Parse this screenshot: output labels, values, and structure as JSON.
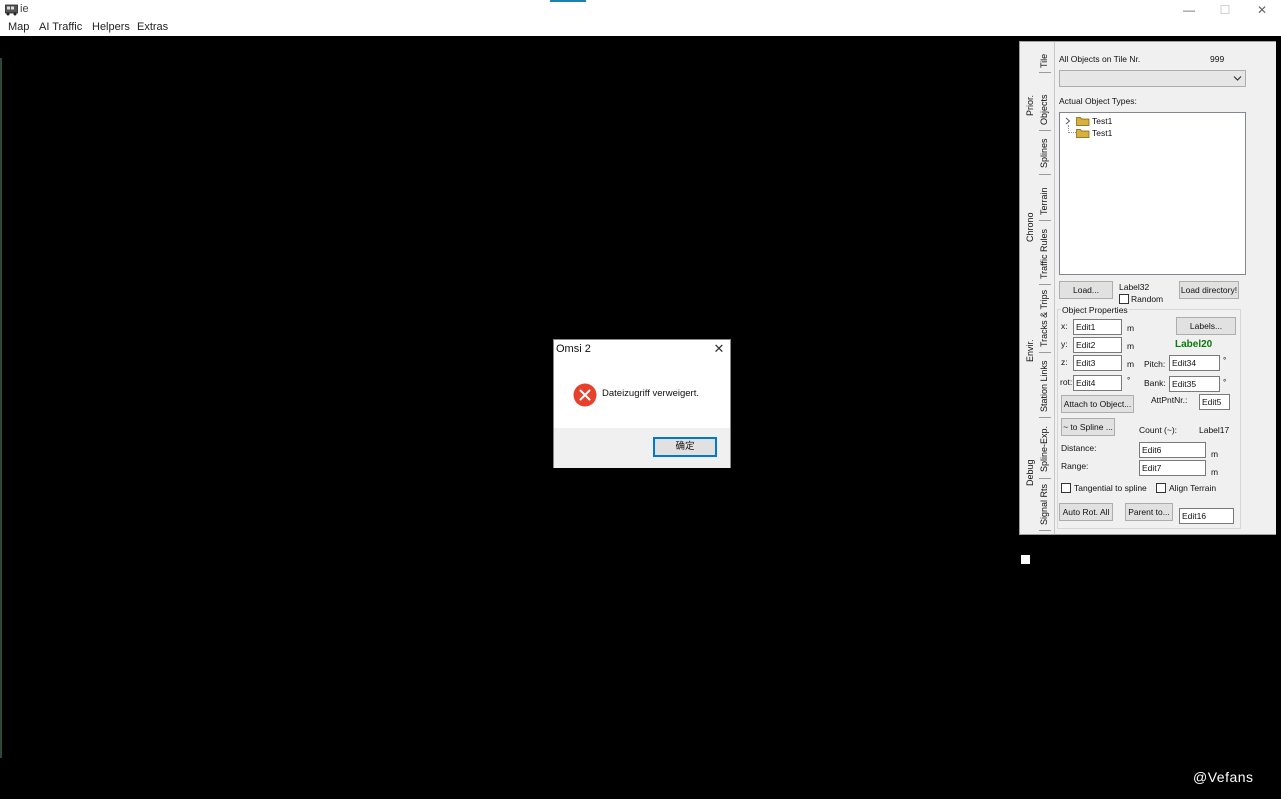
{
  "window": {
    "title": "ie",
    "minimize_glyph": "—",
    "maximize_glyph": "☐",
    "close_glyph": "✕"
  },
  "menu": [
    "Map",
    "AI Traffic",
    "Helpers",
    "Extras"
  ],
  "side_tabs": {
    "right": [
      "Tile",
      "Objects",
      "Splines",
      "Terrain",
      "Traffic Rules",
      "Tracks & Trips",
      "Station Links",
      "Spline-Exp.",
      "Signal Rts"
    ],
    "left": [
      "Prior.",
      "Chrono",
      "Envir.",
      "Debug"
    ]
  },
  "objects_panel": {
    "tile_label": "All Objects on Tile Nr.",
    "tile_number": "999",
    "object_types_label": "Actual Object Types:",
    "tree_items": [
      "Test1",
      "Test1"
    ],
    "load_button": "Load...",
    "label32": "Label32",
    "random_label": "Random",
    "load_directory_button": "Load directory!",
    "properties_group": "Object Properties",
    "x_label": "x:",
    "y_label": "y:",
    "z_label": "z:",
    "rot_label": "rot:",
    "edit1": "Edit1",
    "edit2": "Edit2",
    "edit3": "Edit3",
    "edit4": "Edit4",
    "unit_m": "m",
    "unit_deg": "°",
    "labels_button": "Labels...",
    "label20": "Label20",
    "pitch_label": "Pitch:",
    "edit34": "Edit34",
    "bank_label": "Bank:",
    "edit35": "Edit35",
    "attach_button": "Attach to Object...",
    "attpnt_label": "AttPntNr.:",
    "edit5": "Edit5",
    "to_spline_button": "~ to Spline ...",
    "count_label": "Count (~):",
    "label17": "Label17",
    "distance_label": "Distance:",
    "edit6": "Edit6",
    "range_label": "Range:",
    "edit7": "Edit7",
    "tangential_label": "Tangential to spline",
    "align_terrain_label": "Align Terrain",
    "auto_rot_button": "Auto Rot. All",
    "parent_button": "Parent to...",
    "edit16": "Edit16"
  },
  "dialog": {
    "title": "Omsi 2",
    "message": "Dateizugriff verweigert.",
    "ok_button": "确定",
    "close_glyph": "✕"
  },
  "watermark": "@Vefans",
  "colors": {
    "error_icon": "#e5412d",
    "label20": "#0a7a0a",
    "focus_border": "#0078d7"
  }
}
